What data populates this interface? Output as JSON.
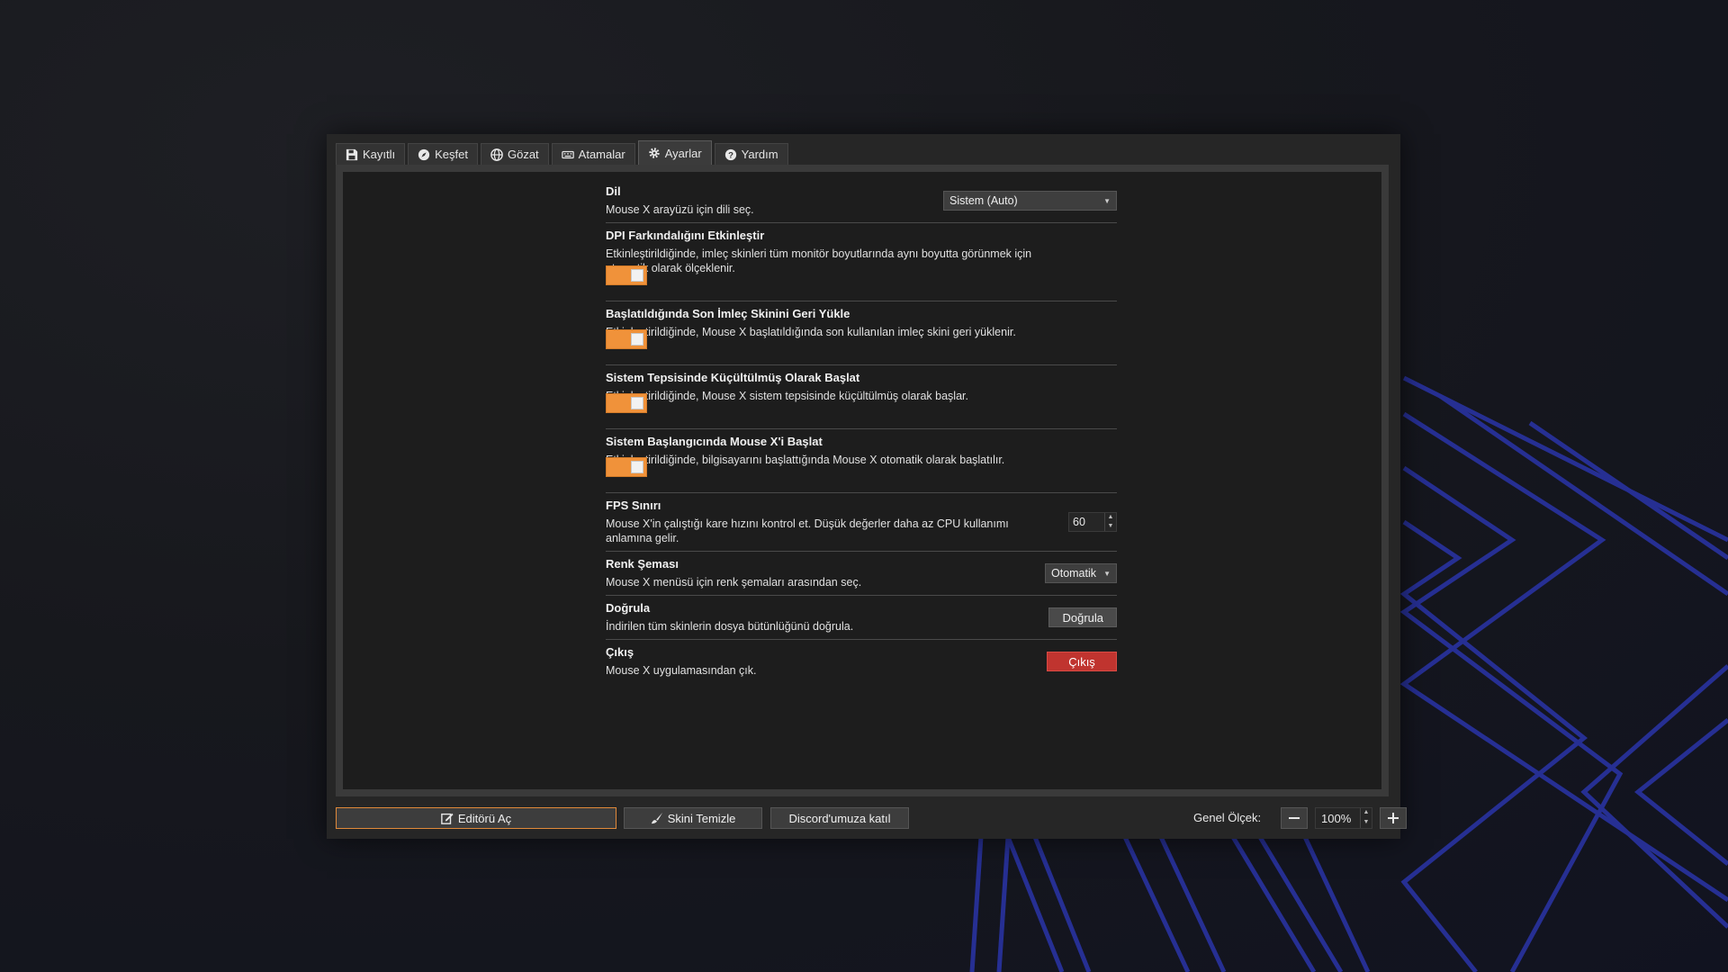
{
  "tabs": [
    {
      "label": "Kayıtlı",
      "icon": "save-icon"
    },
    {
      "label": "Keşfet",
      "icon": "compass-icon"
    },
    {
      "label": "Gözat",
      "icon": "globe-icon"
    },
    {
      "label": "Atamalar",
      "icon": "keyboard-icon"
    },
    {
      "label": "Ayarlar",
      "icon": "gear-icon",
      "active": true
    },
    {
      "label": "Yardım",
      "icon": "help-icon"
    }
  ],
  "settings": {
    "language": {
      "title": "Dil",
      "desc": "Mouse X arayüzü için dili seç.",
      "value": "Sistem (Auto)"
    },
    "dpi": {
      "title": "DPI Farkındalığını Etkinleştir",
      "desc": "Etkinleştirildiğinde, imleç skinleri tüm monitör boyutlarında aynı boyutta görünmek için otomatik olarak ölçeklenir.",
      "enabled": true
    },
    "restore_skin": {
      "title": "Başlatıldığında Son İmleç Skinini Geri Yükle",
      "desc": "Etkinleştirildiğinde, Mouse X başlatıldığında son kullanılan imleç skini geri yüklenir.",
      "enabled": true
    },
    "start_minimized": {
      "title": "Sistem Tepsisinde Küçültülmüş Olarak Başlat",
      "desc": "Etkinleştirildiğinde, Mouse X sistem tepsisinde küçültülmüş olarak başlar.",
      "enabled": true
    },
    "autostart": {
      "title": "Sistem Başlangıcında Mouse X'i Başlat",
      "desc": "Etkinleştirildiğinde, bilgisayarını başlattığında Mouse X otomatik olarak başlatılır.",
      "enabled": true
    },
    "fps": {
      "title": "FPS Sınırı",
      "desc": "Mouse X'in çalıştığı kare hızını kontrol et. Düşük değerler daha az CPU kullanımı anlamına gelir.",
      "value": "60"
    },
    "color_scheme": {
      "title": "Renk Şeması",
      "desc": "Mouse X menüsü için renk şemaları arasından seç.",
      "value": "Otomatik"
    },
    "verify": {
      "title": "Doğrula",
      "desc": "İndirilen tüm skinlerin dosya bütünlüğünü doğrula.",
      "button": "Doğrula"
    },
    "exit": {
      "title": "Çıkış",
      "desc": "Mouse X uygulamasından çık.",
      "button": "Çıkış"
    }
  },
  "footer": {
    "open_editor": "Editörü Aç",
    "clear_skin": "Skini Temizle",
    "discord": "Discord'umuza katıl",
    "scale_label": "Genel Ölçek:",
    "scale_value": "100%"
  },
  "colors": {
    "accent": "#f0923a",
    "danger": "#c0342f",
    "wallpaper_lines": "#2a34a8"
  }
}
